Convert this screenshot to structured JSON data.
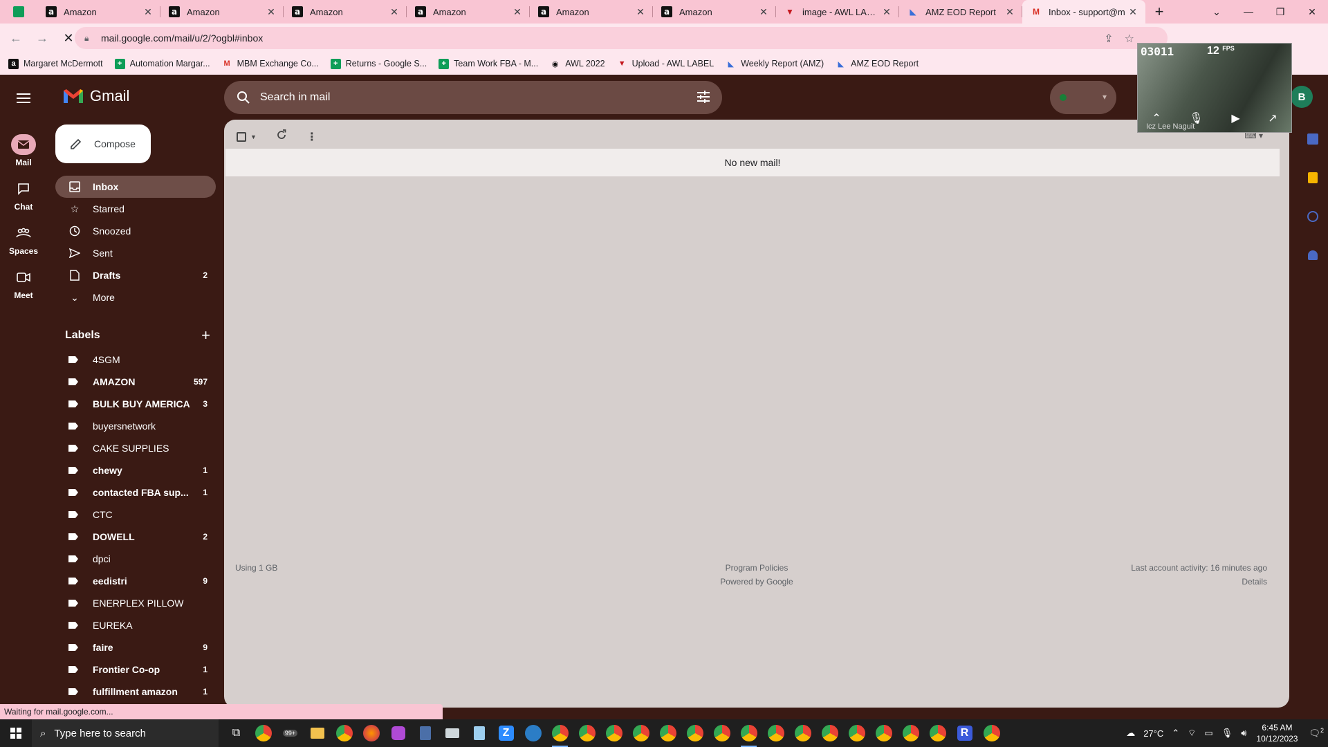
{
  "tabs": [
    {
      "title": "Amazon",
      "favicon": "amazon-icon"
    },
    {
      "title": "Amazon",
      "favicon": "amazon-icon"
    },
    {
      "title": "Amazon",
      "favicon": "amazon-icon"
    },
    {
      "title": "Amazon",
      "favicon": "amazon-icon"
    },
    {
      "title": "Amazon",
      "favicon": "amazon-icon"
    },
    {
      "title": "Amazon",
      "favicon": "amazon-icon"
    },
    {
      "title": "image - AWL LABEL",
      "favicon": "awl-label-icon"
    },
    {
      "title": "AMZ EOD Report",
      "favicon": "report-icon"
    },
    {
      "title": "Inbox - support@m",
      "favicon": "gmail-icon",
      "active": true
    }
  ],
  "address": {
    "url": "mail.google.com/mail/u/2/?ogbl#inbox"
  },
  "bookmarks": [
    {
      "label": "Margaret McDermott",
      "icon": "amazon-icon"
    },
    {
      "label": "Automation Margar...",
      "icon": "sheets-icon"
    },
    {
      "label": "MBM Exchange Co...",
      "icon": "gmail-icon"
    },
    {
      "label": "Returns - Google S...",
      "icon": "sheets-icon"
    },
    {
      "label": "Team Work FBA - M...",
      "icon": "sheets-icon"
    },
    {
      "label": "AWL 2022",
      "icon": "globe-icon"
    },
    {
      "label": "Upload - AWL LABEL",
      "icon": "awl-label-icon"
    },
    {
      "label": "Weekly Report (AMZ)",
      "icon": "report-icon"
    },
    {
      "label": "AMZ EOD Report",
      "icon": "report-icon"
    }
  ],
  "gmail": {
    "brand": "Gmail",
    "search_placeholder": "Search in mail",
    "avatar_letter": "B",
    "rail": [
      {
        "label": "Mail",
        "icon": "mail-icon"
      },
      {
        "label": "Chat",
        "icon": "chat-icon"
      },
      {
        "label": "Spaces",
        "icon": "spaces-icon"
      },
      {
        "label": "Meet",
        "icon": "meet-icon"
      }
    ],
    "compose_label": "Compose",
    "nav": [
      {
        "label": "Inbox",
        "count": "",
        "icon": "inbox-icon"
      },
      {
        "label": "Starred",
        "count": "",
        "icon": "star-icon"
      },
      {
        "label": "Snoozed",
        "count": "",
        "icon": "clock-icon"
      },
      {
        "label": "Sent",
        "count": "",
        "icon": "send-icon"
      },
      {
        "label": "Drafts",
        "count": "2",
        "icon": "draft-icon"
      },
      {
        "label": "More",
        "count": "",
        "icon": "chevron-down-icon"
      }
    ],
    "labels_heading": "Labels",
    "labels": [
      {
        "label": "4SGM",
        "count": ""
      },
      {
        "label": "AMAZON",
        "count": "597"
      },
      {
        "label": "BULK BUY AMERICA",
        "count": "3"
      },
      {
        "label": "buyersnetwork",
        "count": ""
      },
      {
        "label": "CAKE SUPPLIES",
        "count": ""
      },
      {
        "label": "chewy",
        "count": "1"
      },
      {
        "label": "contacted FBA sup...",
        "count": "1"
      },
      {
        "label": "CTC",
        "count": ""
      },
      {
        "label": "DOWELL",
        "count": "2"
      },
      {
        "label": "dpci",
        "count": ""
      },
      {
        "label": "eedistri",
        "count": "9"
      },
      {
        "label": "ENERPLEX PILLOW",
        "count": ""
      },
      {
        "label": "EUREKA",
        "count": ""
      },
      {
        "label": "faire",
        "count": "9"
      },
      {
        "label": "Frontier Co-op",
        "count": "1"
      },
      {
        "label": "fulfillment amazon",
        "count": "1"
      }
    ],
    "empty_message": "No new mail!",
    "footer": {
      "storage": "Using 1 GB",
      "policies": "Program Policies",
      "powered": "Powered by Google",
      "activity": "Last account activity: 16 minutes ago",
      "details": "Details"
    },
    "status_bar": "Waiting for mail.google.com..."
  },
  "video": {
    "timer": "03011",
    "fps": "12",
    "fps_unit": "FPS",
    "name": "Icz Lee Naguit"
  },
  "taskbar": {
    "search_placeholder": "Type here to search",
    "badge": "99+",
    "weather": "27°C",
    "time": "6:45 AM",
    "date": "10/12/2023",
    "notifications": "2"
  },
  "colors": {
    "accent": "#e8a9b8",
    "chrome": "#f9c5d3",
    "background": "#3a1a14"
  }
}
